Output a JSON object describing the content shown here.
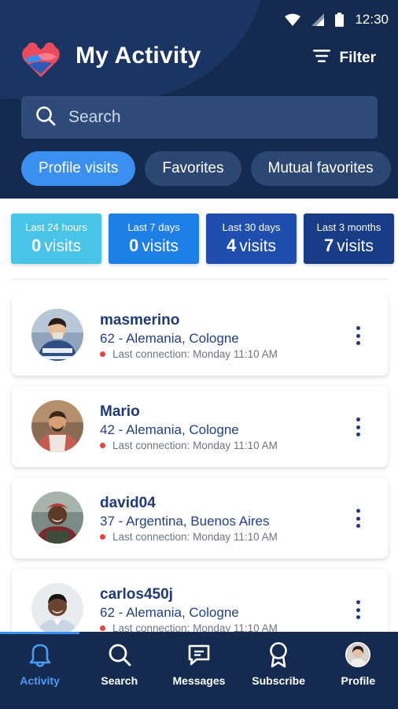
{
  "status_bar": {
    "time": "12:30"
  },
  "header": {
    "title": "My Activity",
    "filter_label": "Filter",
    "search_placeholder": "Search"
  },
  "tabs": [
    {
      "label": "Profile visits",
      "active": true
    },
    {
      "label": "Favorites",
      "active": false
    },
    {
      "label": "Mutual favorites",
      "active": false
    }
  ],
  "periods": [
    {
      "label": "Last 24 hours",
      "count": "0",
      "unit": "visits",
      "color": "#49c3e6"
    },
    {
      "label": "Last 7 days",
      "count": "0",
      "unit": "visits",
      "color": "#1e7fe8"
    },
    {
      "label": "Last 30 days",
      "count": "4",
      "unit": "visits",
      "color": "#1e4fae"
    },
    {
      "label": "Last 3 months",
      "count": "7",
      "unit": "visits",
      "color": "#183c86"
    }
  ],
  "users": [
    {
      "name": "masmerino",
      "meta": "62 - Alemania, Cologne",
      "last_connection": "Last connection: Monday 11:10 AM"
    },
    {
      "name": "Mario",
      "meta": "42 - Alemania, Cologne",
      "last_connection": "Last connection: Monday 11:10 AM"
    },
    {
      "name": "david04",
      "meta": "37 - Argentina, Buenos Aires",
      "last_connection": "Last connection: Monday 11:10 AM"
    },
    {
      "name": "carlos450j",
      "meta": "62 - Alemania, Cologne",
      "last_connection": "Last connection: Monday 11:10 AM"
    }
  ],
  "nav": [
    {
      "label": "Activity",
      "icon": "bell-icon",
      "active": true
    },
    {
      "label": "Search",
      "icon": "search-icon",
      "active": false
    },
    {
      "label": "Messages",
      "icon": "chat-icon",
      "active": false
    },
    {
      "label": "Subscribe",
      "icon": "badge-icon",
      "active": false
    },
    {
      "label": "Profile",
      "icon": "avatar",
      "active": false
    }
  ],
  "colors": {
    "header": "#142a4f",
    "accent": "#3b8ff0",
    "text_primary": "#1f3a78",
    "online_dot": "#e8433c"
  }
}
